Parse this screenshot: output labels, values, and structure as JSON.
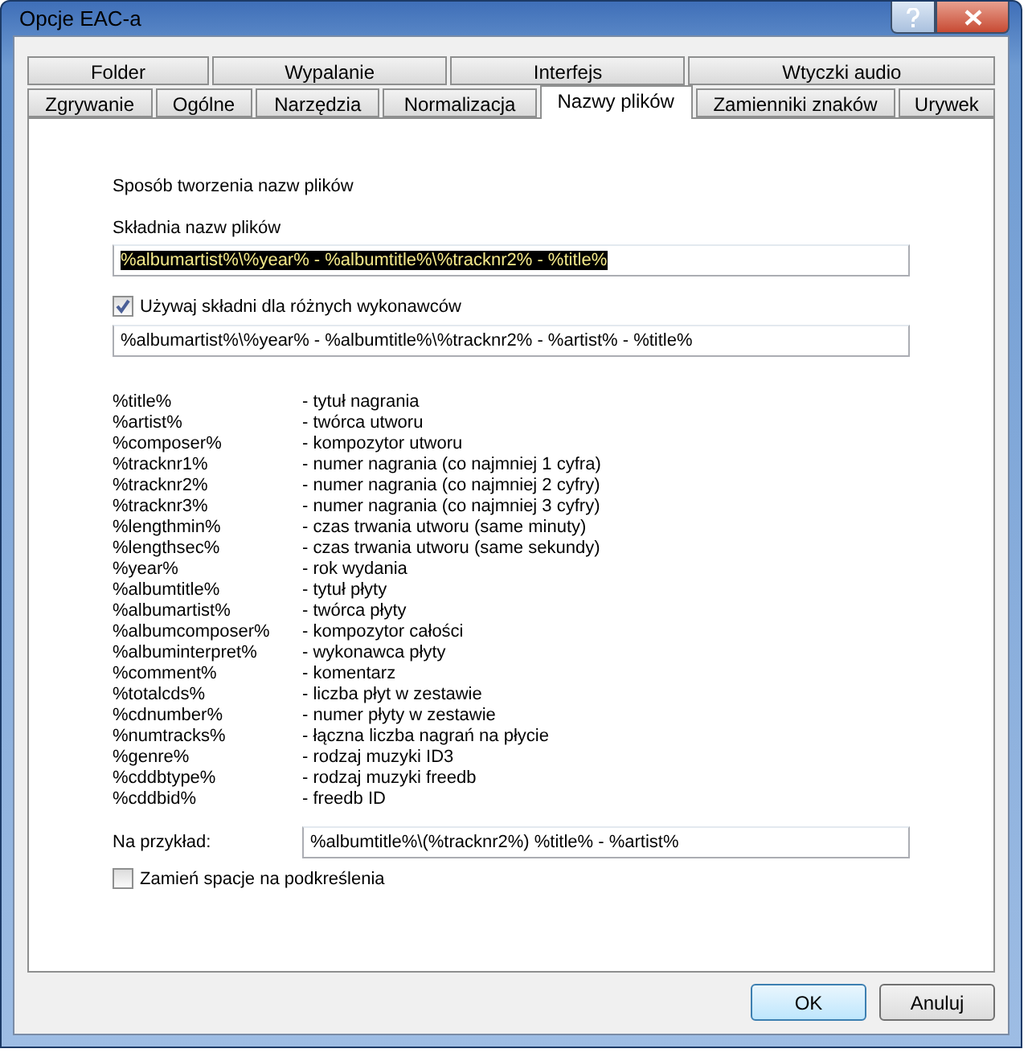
{
  "window": {
    "title": "Opcje EAC-a"
  },
  "tab_rows": [
    [
      {
        "label": "Folder",
        "selected": false
      },
      {
        "label": "Wypalanie",
        "selected": false
      },
      {
        "label": "Interfejs",
        "selected": false
      },
      {
        "label": "Wtyczki audio",
        "selected": false
      }
    ],
    [
      {
        "label": "Zgrywanie",
        "selected": false
      },
      {
        "label": "Ogólne",
        "selected": false
      },
      {
        "label": "Narzędzia",
        "selected": false
      },
      {
        "label": "Normalizacja",
        "selected": false
      },
      {
        "label": "Nazwy plików",
        "selected": true
      },
      {
        "label": "Zamienniki znaków",
        "selected": false
      },
      {
        "label": "Urywek",
        "selected": false
      }
    ]
  ],
  "section_title": "Sposób tworzenia nazw plików",
  "naming": {
    "label": "Składnia nazw plików",
    "value": "%albumartist%\\%year% - %albumtitle%\\%tracknr2% - %title%",
    "text_selected": true
  },
  "various_artists": {
    "label": "Używaj składni dla różnych wykonawców",
    "checked": true,
    "value": "%albumartist%\\%year% - %albumtitle%\\%tracknr2% - %artist% - %title%"
  },
  "placeholders": [
    {
      "token": "%title%",
      "description": "- tytuł nagrania"
    },
    {
      "token": "%artist%",
      "description": "- twórca utworu"
    },
    {
      "token": "%composer%",
      "description": "- kompozytor utworu"
    },
    {
      "token": "%tracknr1%",
      "description": "- numer nagrania (co najmniej 1 cyfra)"
    },
    {
      "token": "%tracknr2%",
      "description": "- numer nagrania (co najmniej 2 cyfry)"
    },
    {
      "token": "%tracknr3%",
      "description": "- numer nagrania (co najmniej 3 cyfry)"
    },
    {
      "token": "%lengthmin%",
      "description": "- czas trwania utworu (same minuty)"
    },
    {
      "token": "%lengthsec%",
      "description": "- czas trwania utworu (same sekundy)"
    },
    {
      "token": "%year%",
      "description": "- rok wydania"
    },
    {
      "token": "%albumtitle%",
      "description": "- tytuł płyty"
    },
    {
      "token": "%albumartist%",
      "description": "- twórca płyty"
    },
    {
      "token": "%albumcomposer%",
      "description": "- kompozytor całości"
    },
    {
      "token": "%albuminterpret%",
      "description": "- wykonawca płyty"
    },
    {
      "token": "%comment%",
      "description": "- komentarz"
    },
    {
      "token": "%totalcds%",
      "description": "- liczba płyt w zestawie"
    },
    {
      "token": "%cdnumber%",
      "description": "- numer płyty w zestawie"
    },
    {
      "token": "%numtracks%",
      "description": "- łączna liczba nagrań na płycie"
    },
    {
      "token": "%genre%",
      "description": "- rodzaj muzyki ID3"
    },
    {
      "token": "%cddbtype%",
      "description": "- rodzaj muzyki freedb"
    },
    {
      "token": "%cddbid%",
      "description": "- freedb ID"
    }
  ],
  "example": {
    "label": "Na przykład:",
    "value": "%albumtitle%\\(%tracknr2%) %title% - %artist%"
  },
  "replace_spaces": {
    "label": "Zamień spacje na podkreślenia",
    "checked": false
  },
  "buttons": [
    {
      "label": "OK",
      "default": true
    },
    {
      "label": "Anuluj",
      "default": false
    }
  ]
}
